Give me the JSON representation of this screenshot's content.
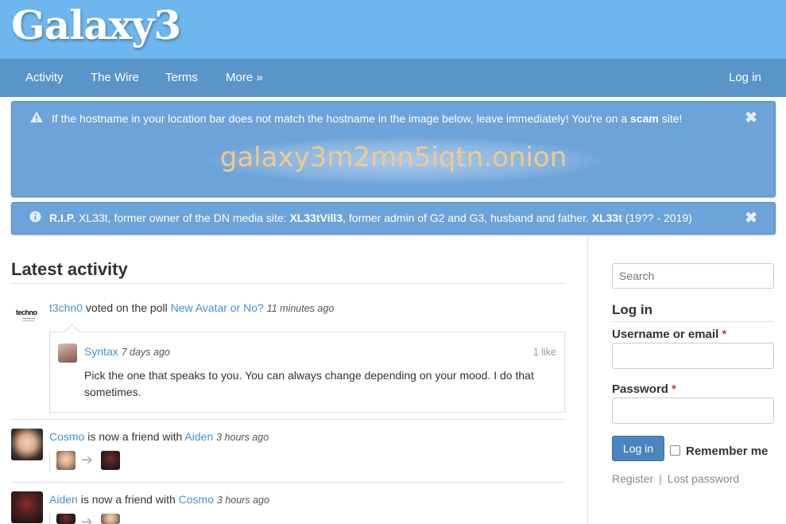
{
  "site": {
    "title": "Galaxy3"
  },
  "nav": {
    "items": [
      {
        "label": "Activity"
      },
      {
        "label": "The Wire"
      },
      {
        "label": "Terms"
      },
      {
        "label": "More »"
      }
    ],
    "login": "Log in"
  },
  "alerts": {
    "warning": {
      "icon": "warning-icon",
      "text_before": "If the hostname in your location bar does not match the hostname in the image below, leave immediately! You're on a ",
      "text_bold": "scam",
      "text_after": " site!",
      "hostname": "galaxy3m2mn5iqtn.onion"
    },
    "rip": {
      "icon": "info-icon",
      "p1": "R.I.P.",
      "p2": " XL33t, former owner of the DN media site: ",
      "p3": "XL33tVill3",
      "p4": ", former admin of G2 and G3, husband and father. ",
      "p5": "XL33t",
      "p6": " (19?? - 2019)"
    },
    "close_glyph": "✖"
  },
  "main": {
    "title": "Latest activity",
    "activities": [
      {
        "actor": "t3chn0",
        "verb": " voted on the poll ",
        "target": "New Avatar or No?",
        "time": "11 minutes ago",
        "avatar_text": "techno",
        "comment": {
          "author": "Syntax",
          "time": "7 days ago",
          "likes": "1 like",
          "body": "Pick the one that speaks to you. You can always change depending on your mood. I do that sometimes."
        }
      },
      {
        "actor": "Cosmo",
        "verb": " is now a friend with ",
        "target": "Aiden",
        "time": "3 hours ago"
      },
      {
        "actor": "Aiden",
        "verb": " is now a friend with ",
        "target": "Cosmo",
        "time": "3 hours ago"
      }
    ],
    "arrow_glyph": "➔"
  },
  "sidebar": {
    "search_placeholder": "Search",
    "login_heading": "Log in",
    "username_label": "Username or email",
    "password_label": "Password",
    "required_mark": "*",
    "login_button": "Log in",
    "remember_label": "Remember me",
    "register": "Register",
    "separator": "|",
    "lost_password": "Lost password"
  },
  "colors": {
    "header": "#6eb6ee",
    "nav": "#5a95c9",
    "alert": "#6ca3d8",
    "link": "#4690d6",
    "hostname": "#f3c98a",
    "button": "#4a85be"
  }
}
